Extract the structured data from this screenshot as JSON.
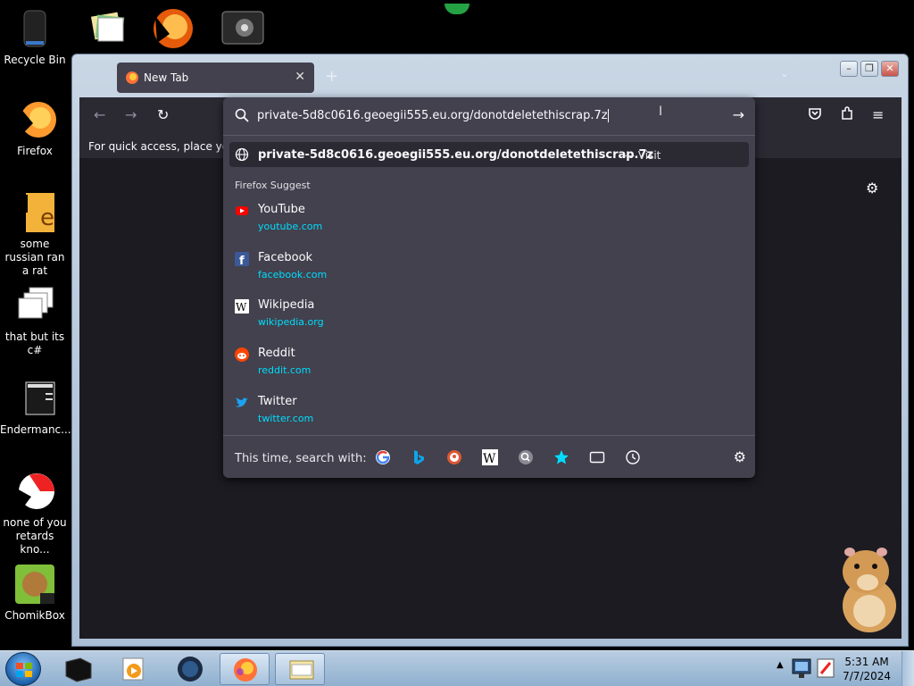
{
  "desktop_icons": [
    {
      "label": "Recycle Bin",
      "icon": "recycle-bin-icon"
    },
    {
      "label": "Firefox",
      "icon": "firefox-icon"
    },
    {
      "label": "some russian ran a rat",
      "icon": "program-shortcut-icon"
    },
    {
      "label": "that but its c#",
      "icon": "windows-stack-icon"
    },
    {
      "label": "Endermanc...",
      "icon": "program-window-icon"
    },
    {
      "label": "none of you retards kno...",
      "icon": "app-icon"
    },
    {
      "label": "ChomikBox",
      "icon": "chomikbox-icon"
    }
  ],
  "browser": {
    "tab_title": "New Tab",
    "bookmark_hint": "For quick access, place your b",
    "url_text": "private-5d8c0616.geoegii555.eu.org/donotdeletethiscrap.7z",
    "first_result": {
      "url": "private-5d8c0616.geoegii555.eu.org/donotdeletethiscrap.7z",
      "action": "— Visit"
    },
    "suggest_header": "Firefox Suggest",
    "suggestions": [
      {
        "name": "YouTube",
        "domain": "youtube.com",
        "icon": "youtube-icon"
      },
      {
        "name": "Facebook",
        "domain": "facebook.com",
        "icon": "facebook-icon"
      },
      {
        "name": "Wikipedia",
        "domain": "wikipedia.org",
        "icon": "wikipedia-icon"
      },
      {
        "name": "Reddit",
        "domain": "reddit.com",
        "icon": "reddit-icon"
      },
      {
        "name": "Twitter",
        "domain": "twitter.com",
        "icon": "twitter-icon"
      }
    ],
    "search_with_label": "This time, search with:",
    "engines": [
      "google-icon",
      "bing-icon",
      "duckduckgo-icon",
      "wikipedia-icon",
      "search-icon",
      "bookmarks-star-icon",
      "tabs-icon",
      "history-clock-icon"
    ]
  },
  "taskbar": {
    "time": "5:31 AM",
    "date": "7/7/2024"
  },
  "colors": {
    "firefox_dark": "#1c1b22",
    "urlbar": "#42414d",
    "link_cyan": "#00ddff"
  }
}
